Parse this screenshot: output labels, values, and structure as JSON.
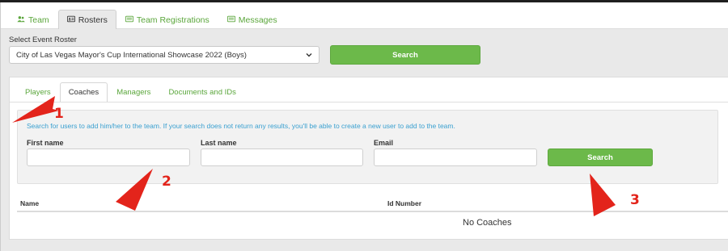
{
  "main_tabs": [
    {
      "label": "Team",
      "icon": "users-icon",
      "active": false
    },
    {
      "label": "Rosters",
      "icon": "id-card-icon",
      "active": true
    },
    {
      "label": "Team Registrations",
      "icon": "list-icon",
      "active": false
    },
    {
      "label": "Messages",
      "icon": "list-icon",
      "active": false
    }
  ],
  "event_roster": {
    "label": "Select Event Roster",
    "selected": "City of Las Vegas Mayor's Cup International Showcase 2022 (Boys)",
    "search_button": "Search"
  },
  "sub_tabs": [
    {
      "label": "Players",
      "active": false
    },
    {
      "label": "Coaches",
      "active": true
    },
    {
      "label": "Managers",
      "active": false
    },
    {
      "label": "Documents and IDs",
      "active": false
    }
  ],
  "search_form": {
    "hint": "Search for users to add him/her to the team. If your search does not return any results, you'll be able to create a new user to add to the team.",
    "first_name_label": "First name",
    "first_name_value": "",
    "last_name_label": "Last name",
    "last_name_value": "",
    "email_label": "Email",
    "email_value": "",
    "search_button": "Search"
  },
  "table": {
    "columns": [
      "Name",
      "Id Number"
    ],
    "empty_text": "No Coaches"
  },
  "annotations": {
    "marker_1": "1",
    "marker_2": "2",
    "marker_3": "3",
    "arrow_color": "#e3241b"
  },
  "colors": {
    "accent_green": "#6cb94a",
    "link_green": "#5aa63b",
    "hint_blue": "#3aa0d0"
  }
}
